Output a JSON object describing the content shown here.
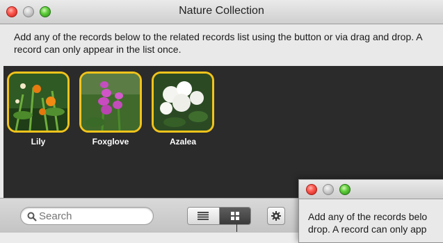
{
  "window": {
    "title": "Nature Collection",
    "description": "Add any of the records below to the related records list using the button or via drag and drop.  A record can only appear in the list once."
  },
  "records": [
    {
      "label": "Lily",
      "icon": "lily-photo"
    },
    {
      "label": "Foxglove",
      "icon": "foxglove-photo"
    },
    {
      "label": "Azalea",
      "icon": "azalea-photo"
    }
  ],
  "toolbar": {
    "search_placeholder": "Search",
    "view_modes": [
      "list-view-icon",
      "grid-view-icon"
    ],
    "active_view": "grid-view-icon",
    "action_icon": "gear-icon"
  },
  "second_window": {
    "description_line1": "Add any of the records belo",
    "description_line2": "drop.  A record can only app"
  },
  "colors": {
    "selection_border": "#f1c31b",
    "panel_background": "#2b2b2b"
  }
}
